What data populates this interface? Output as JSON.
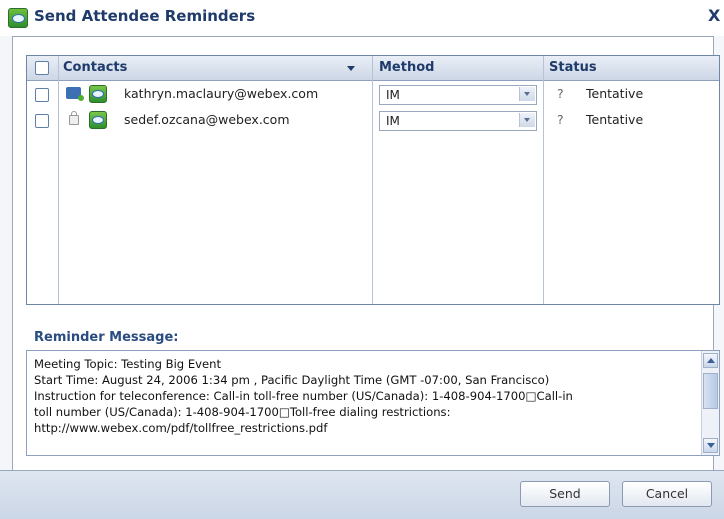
{
  "window": {
    "title": "Send Attendee Reminders",
    "close_glyph": "X"
  },
  "grid": {
    "headers": {
      "contacts": "Contacts",
      "method": "Method",
      "status": "Status"
    },
    "rows": [
      {
        "email": "kathryn.maclaury@webex.com",
        "presence_icon": "im-online-icon",
        "method": "IM",
        "status_glyph": "?",
        "status": "Tentative"
      },
      {
        "email": "sedef.ozcana@webex.com",
        "presence_icon": "lock-icon",
        "method": "IM",
        "status_glyph": "?",
        "status": "Tentative"
      }
    ]
  },
  "reminder": {
    "label": "Reminder Message:",
    "lines": [
      "Meeting Topic: Testing Big Event",
      "Start Time: August 24, 2006 1:34 pm , Pacific Daylight Time (GMT -07:00, San Francisco)",
      "Instruction for teleconference: Call-in toll-free number (US/Canada): 1-408-904-1700□Call-in",
      "toll number (US/Canada): 1-408-904-1700□Toll-free dialing restrictions:",
      "http://www.webex.com/pdf/tollfree_restrictions.pdf"
    ]
  },
  "buttons": {
    "send": "Send",
    "cancel": "Cancel"
  },
  "colors": {
    "title": "#1f3b6b",
    "header_bg": "#cdd7e6",
    "footer_bg": "#cbd6e6"
  }
}
